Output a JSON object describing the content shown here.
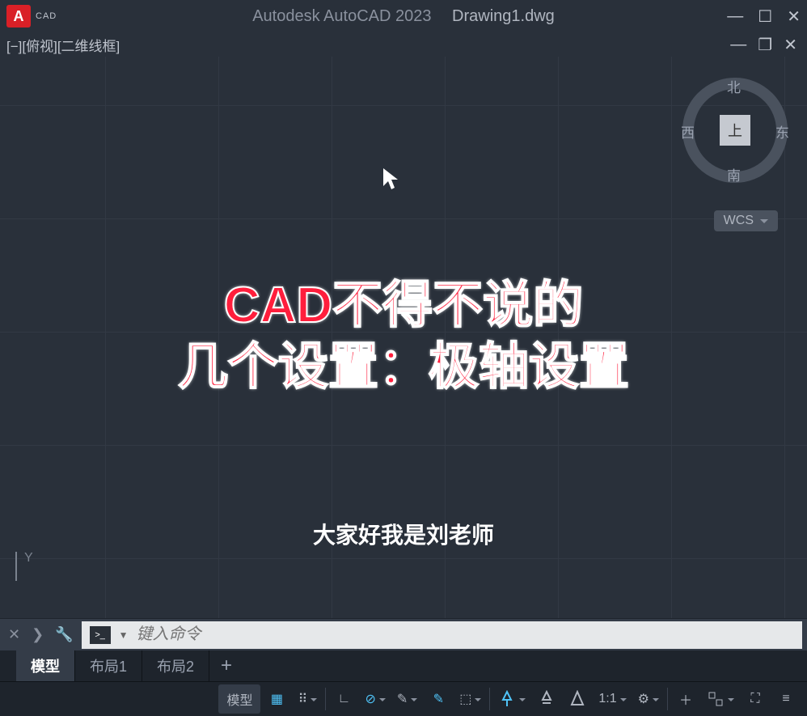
{
  "titlebar": {
    "app_icon_letter": "A",
    "app_tag": "CAD",
    "product": "Autodesk AutoCAD 2023",
    "filename": "Drawing1.dwg"
  },
  "viewport": {
    "label": "[−][俯视][二维线框]"
  },
  "viewcube": {
    "center": "上",
    "north": "北",
    "south": "南",
    "west": "西",
    "east": "东",
    "wcs": "WCS"
  },
  "overlay": {
    "line1": "CAD不得不说的",
    "line2": "几个设置：极轴设置",
    "subtitle": "大家好我是刘老师"
  },
  "command": {
    "prompt_icon": ">_",
    "placeholder": "键入命令"
  },
  "tabs": {
    "model": "模型",
    "layout1": "布局1",
    "layout2": "布局2",
    "add": "+"
  },
  "status": {
    "model_label": "模型",
    "scale": "1:1"
  },
  "icons": {
    "minimize": "—",
    "maximize": "☐",
    "close": "✕",
    "doc_min": "—",
    "doc_max": "❐",
    "doc_close": "✕",
    "cursor": "↖",
    "cmd_close": "✕",
    "chevron": "❯",
    "wrench": "🔧",
    "dropdown": "▼",
    "grid": "▦",
    "dots": "⠿",
    "angle": "∟",
    "polar": "⊘",
    "pen": "✎",
    "iso": "⬚",
    "person": "⛹",
    "gear": "⚙",
    "plus": "＋",
    "lines": "≡",
    "expand": "⛶"
  }
}
